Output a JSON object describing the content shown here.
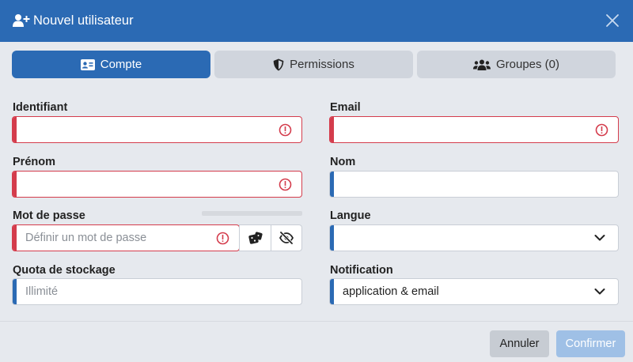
{
  "dialog": {
    "title": "Nouvel utilisateur",
    "title_icon": "user-plus-icon",
    "close_icon": "close-icon"
  },
  "tabs": [
    {
      "label": "Compte",
      "icon": "id-card-icon",
      "active": true
    },
    {
      "label": "Permissions",
      "icon": "shield-icon",
      "active": false
    },
    {
      "label": "Groupes (0)",
      "icon": "users-icon",
      "active": false
    }
  ],
  "form": {
    "identifiant": {
      "label": "Identifiant",
      "value": "",
      "error": true
    },
    "email": {
      "label": "Email",
      "value": "",
      "error": true
    },
    "prenom": {
      "label": "Prénom",
      "value": "",
      "error": true
    },
    "nom": {
      "label": "Nom",
      "value": "",
      "error": false
    },
    "password": {
      "label": "Mot de passe",
      "placeholder": "Définir un mot de passe",
      "error": true
    },
    "langue": {
      "label": "Langue",
      "value": ""
    },
    "quota": {
      "label": "Quota de stockage",
      "placeholder": "Illimité"
    },
    "notification": {
      "label": "Notification",
      "value": "application & email"
    }
  },
  "buttons": {
    "cancel": "Annuler",
    "confirm": "Confirmer"
  },
  "colors": {
    "primary": "#2b6ab4",
    "error": "#d43c4c",
    "confirm_disabled": "#9fc0e6"
  }
}
